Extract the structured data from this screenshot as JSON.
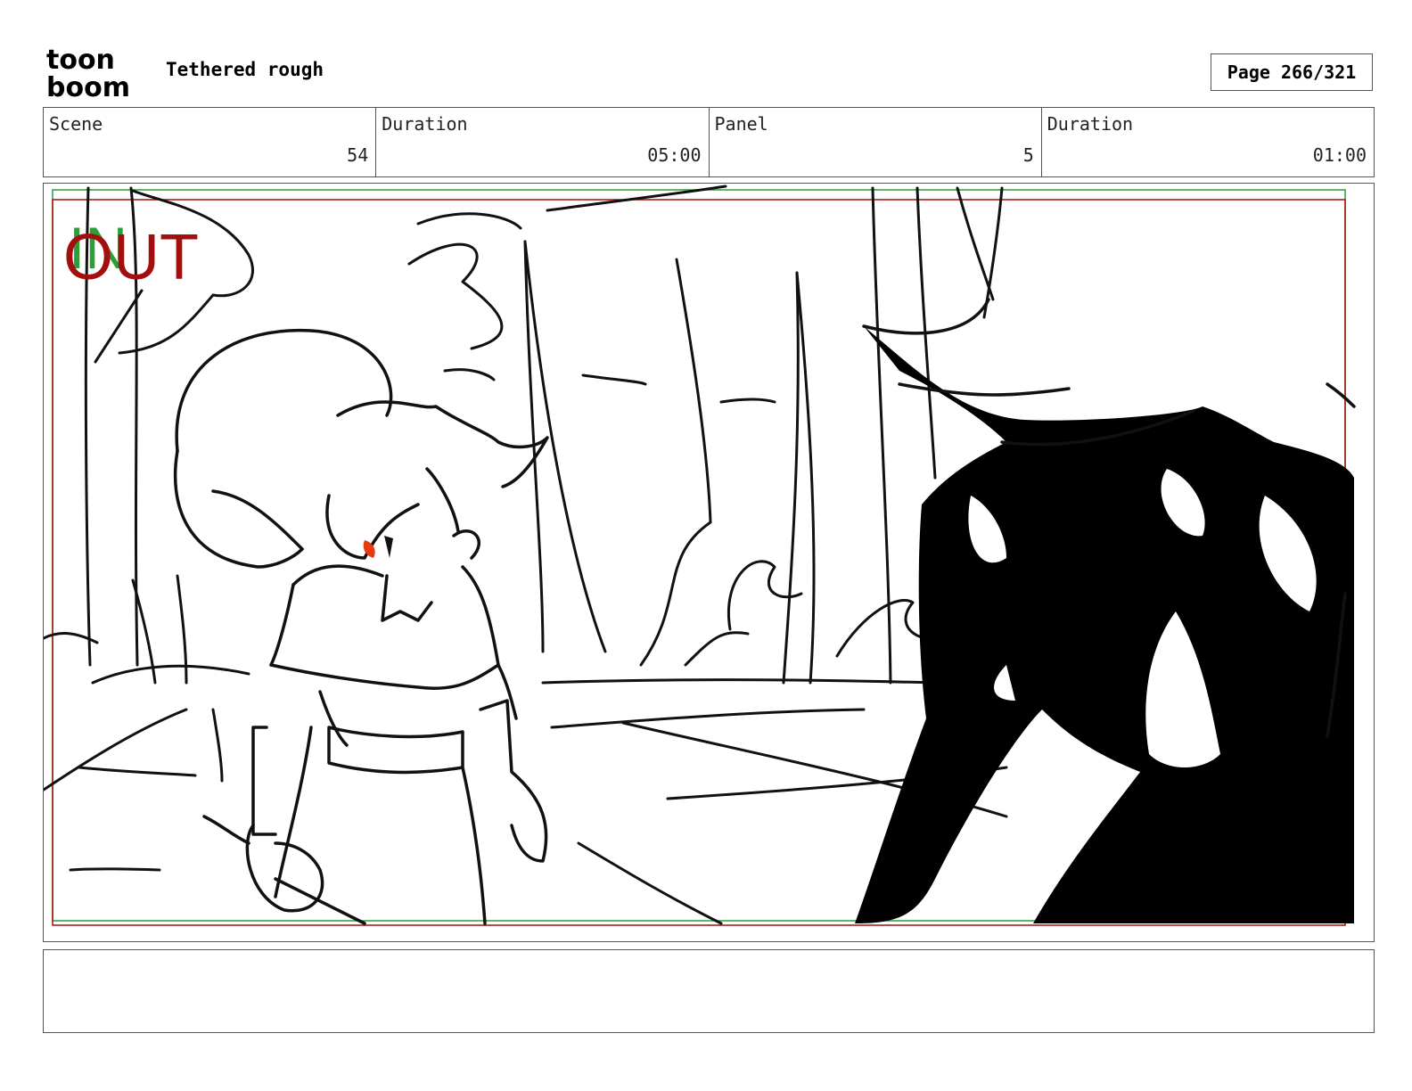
{
  "header": {
    "logo_text_top": "toon",
    "logo_text_bottom": "boom",
    "document_title": "Tethered rough",
    "page_label": "Page 266/321"
  },
  "info": {
    "scene_label": "Scene",
    "scene_value": "54",
    "scene_duration_label": "Duration",
    "scene_duration_value": "05:00",
    "panel_label": "Panel",
    "panel_value": "5",
    "panel_duration_label": "Duration",
    "panel_duration_value": "01:00"
  },
  "frame": {
    "in_label": "IN",
    "out_label": "OUT",
    "in_color": "#2e9e3a",
    "out_color": "#a30f0f"
  },
  "notes": {
    "text": ""
  }
}
